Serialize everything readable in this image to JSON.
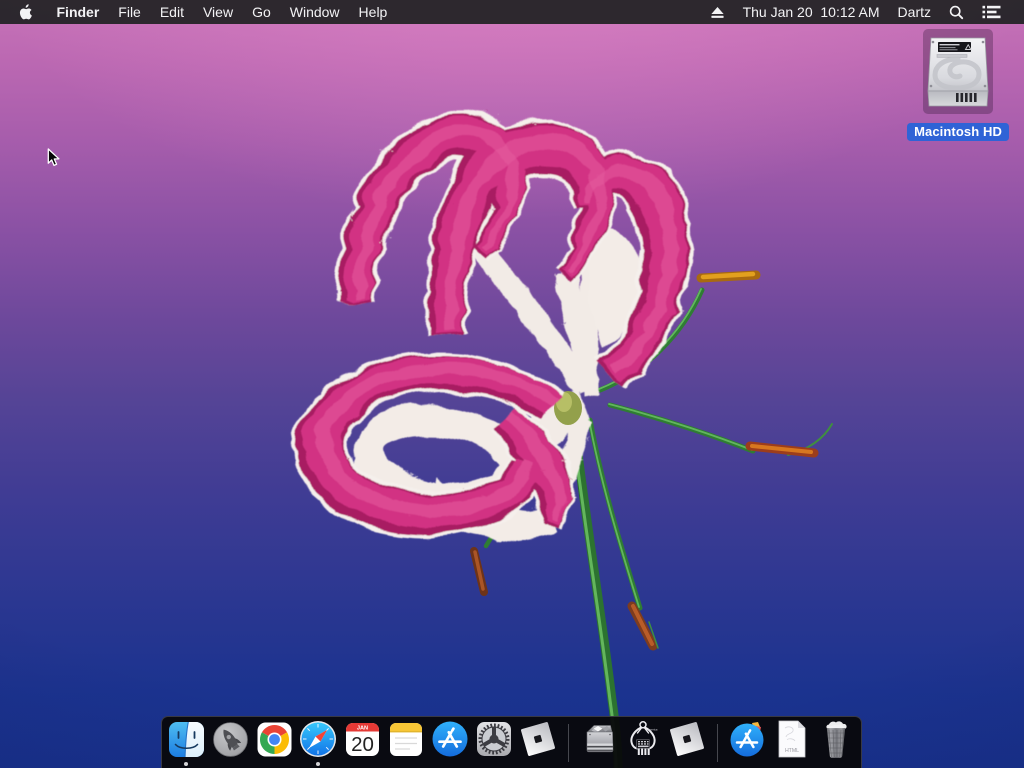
{
  "menu_bar": {
    "apple_icon": "apple-logo",
    "menus": [
      {
        "label": "Finder",
        "bold": true
      },
      {
        "label": "File"
      },
      {
        "label": "Edit"
      },
      {
        "label": "View"
      },
      {
        "label": "Go"
      },
      {
        "label": "Window"
      },
      {
        "label": "Help"
      }
    ],
    "status": {
      "eject_icon": "eject",
      "clock": "Thu Jan 20  10:12 AM",
      "user": "Dartz",
      "search_icon": "magnifier",
      "notification_icon": "list-menu"
    }
  },
  "desktop": {
    "wallpaper": "gloriosa-lily-on-pink-blue-gradient",
    "icons": [
      {
        "label": "Macintosh HD",
        "selected": true
      }
    ]
  },
  "dock": {
    "items": [
      {
        "name": "finder",
        "running": true
      },
      {
        "name": "launchpad",
        "running": false
      },
      {
        "name": "chrome",
        "running": false
      },
      {
        "name": "safari",
        "running": true
      },
      {
        "name": "calendar",
        "running": false,
        "month": "JAN",
        "day": "20"
      },
      {
        "name": "notes",
        "running": false
      },
      {
        "name": "app-store",
        "running": false
      },
      {
        "name": "system-preferences",
        "running": false
      },
      {
        "name": "roblox",
        "running": false
      },
      {
        "name": "separator"
      },
      {
        "name": "hard-drive",
        "running": false
      },
      {
        "name": "chip-claw-tool",
        "running": false
      },
      {
        "name": "roblox-2",
        "running": false
      },
      {
        "name": "separator"
      },
      {
        "name": "applications-stack",
        "running": false
      },
      {
        "name": "html-file",
        "label": "HTML"
      },
      {
        "name": "trash-full"
      }
    ]
  },
  "colors": {
    "selection_blue": "#2f63d6",
    "menubar_bg": "#1b1a1d",
    "dock_bg": "#0f0f14"
  }
}
